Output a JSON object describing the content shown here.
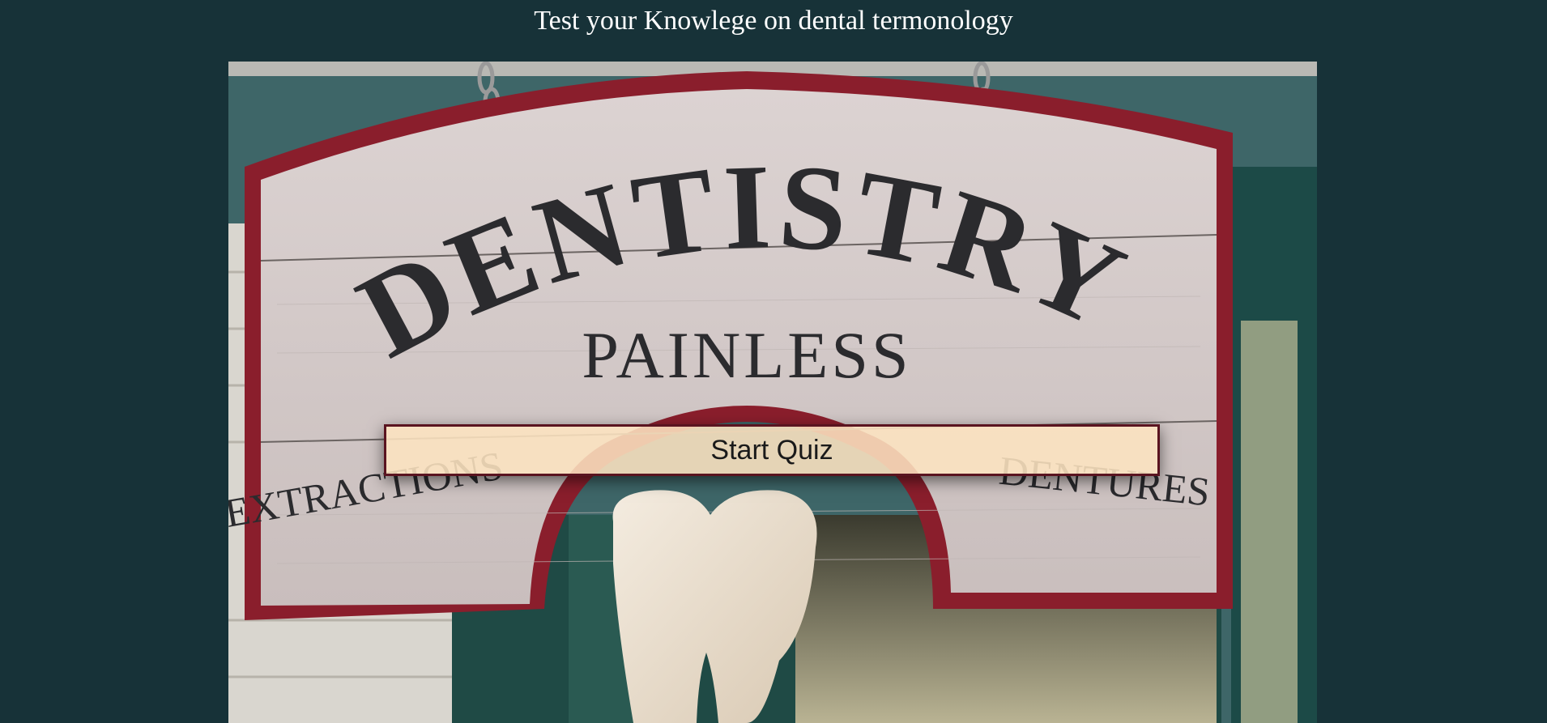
{
  "page": {
    "title": "Test your Knowlege on dental termonology"
  },
  "hero": {
    "image_description_icon": "dentistry-sign-image",
    "sign_main": "DENTISTRY",
    "sign_sub": "PAINLESS",
    "sign_left": "EXTRACTIONS",
    "sign_right": "DENTURES"
  },
  "quiz": {
    "start_label": "Start Quiz"
  },
  "colors": {
    "background": "#173238",
    "button_fill": "#fde4c0",
    "button_border": "#5a1420",
    "sign_frame": "#8a1e2c"
  }
}
